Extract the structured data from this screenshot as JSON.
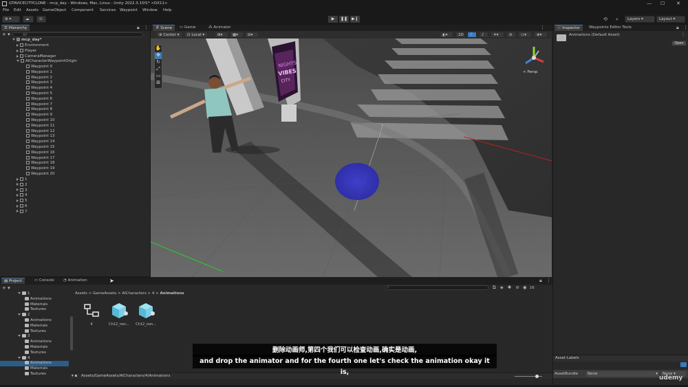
{
  "window": {
    "title": "GTAVICECITYCLONE - mcp_day - Windows, Mac, Linux - Unity 2022.3.15f1* <DX11>",
    "minimize": "—",
    "maximize": "☐",
    "close": "✕"
  },
  "menu": [
    "File",
    "Edit",
    "Assets",
    "GameObject",
    "Component",
    "Services",
    "Waypoint",
    "Window",
    "Help"
  ],
  "toolbar": {
    "account_label": "⊕ ▾",
    "cloud_label": "☁",
    "play_icon": "▶",
    "pause_icon": "❚❚",
    "step_icon": "▶❙",
    "layers_label": "Layers",
    "layout_label": "Layout"
  },
  "hierarchy": {
    "tab": "Hierarchy",
    "search_placeholder": "All",
    "scene_name": "mcp_day*",
    "items": [
      {
        "label": "Environment",
        "indent": 1,
        "expanded": false
      },
      {
        "label": "Player",
        "indent": 1,
        "expanded": false
      },
      {
        "label": "CameraManager",
        "indent": 1,
        "expanded": false
      },
      {
        "label": "AICharacterWaypointOrigin",
        "indent": 1,
        "expanded": true
      }
    ],
    "waypoints": [
      "Waypoint 0",
      "Waypoint 1",
      "Waypoint 2",
      "Waypoint 3",
      "Waypoint 4",
      "Waypoint 5",
      "Waypoint 6",
      "Waypoint 7",
      "Waypoint 8",
      "Waypoint 9",
      "Waypoint 10",
      "Waypoint 11",
      "Waypoint 12",
      "Waypoint 13",
      "Waypoint 14",
      "Waypoint 15",
      "Waypoint 16",
      "Waypoint 17",
      "Waypoint 18",
      "Waypoint 19",
      "Waypoint 20"
    ],
    "roots": [
      "1",
      "2",
      "3",
      "4",
      "5",
      "6",
      "7"
    ]
  },
  "scene": {
    "tabs": [
      "Scene",
      "Game",
      "Animator"
    ],
    "pivot_center": "Center",
    "pivot_local": "Local",
    "mode_2d": "2D",
    "persp_label": "< Persp",
    "sign_text_top": "NIGHTS",
    "sign_text_mid": "VIBES",
    "sign_text_bottom": "CITY"
  },
  "inspector": {
    "tabs": [
      "Inspector",
      "Waypoints Editor Tools"
    ],
    "asset_title": "Animations (Default Asset)",
    "open_button": "Open",
    "asset_labels": "Asset Labels",
    "assetbundle_label": "AssetBundle",
    "assetbundle_value": "None",
    "variant_value": "None"
  },
  "project": {
    "tabs": [
      "Project",
      "Console",
      "Animation"
    ],
    "add_label": "+ ▾",
    "tree": [
      {
        "label": "1",
        "indent": 0,
        "type": "root"
      },
      {
        "label": "Animations",
        "indent": 1
      },
      {
        "label": "Materials",
        "indent": 1
      },
      {
        "label": "Textures",
        "indent": 1
      },
      {
        "label": "2",
        "indent": 0,
        "type": "root"
      },
      {
        "label": "Animations",
        "indent": 1
      },
      {
        "label": "Materials",
        "indent": 1
      },
      {
        "label": "Textures",
        "indent": 1
      },
      {
        "label": "3",
        "indent": 0,
        "type": "root"
      },
      {
        "label": "Animations",
        "indent": 1
      },
      {
        "label": "Materials",
        "indent": 1
      },
      {
        "label": "Textures",
        "indent": 1
      },
      {
        "label": "4",
        "indent": 0,
        "type": "root"
      },
      {
        "label": "Animations",
        "indent": 1,
        "selected": true
      },
      {
        "label": "Materials",
        "indent": 1
      },
      {
        "label": "Textures",
        "indent": 1
      }
    ],
    "breadcrumb": [
      "Assets",
      "GameAssets",
      "AICharacters",
      "4",
      "Animations"
    ],
    "assets": [
      {
        "label": "4",
        "kind": "controller"
      },
      {
        "label": "Ch12_non...",
        "kind": "fbx"
      },
      {
        "label": "Ch12_non...",
        "kind": "fbx"
      }
    ],
    "path_bar": "Assets/GameAssets/AICharacters/4/Animations",
    "count_badge": "16"
  },
  "subtitles": {
    "line_cn": "删除动画师,第四个我们可以检查动画,确实是动画,",
    "line_en": "and drop the animator and for the fourth one let's check the animation okay it is,"
  },
  "watermark": "udemy"
}
